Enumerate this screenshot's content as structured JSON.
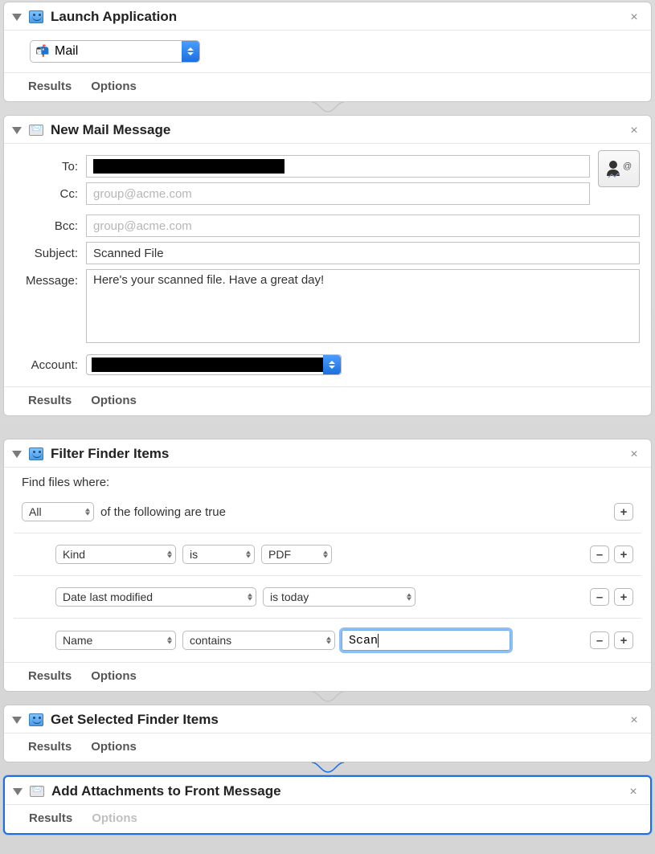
{
  "cards": {
    "launch": {
      "title": "Launch Application",
      "app_name": "Mail"
    },
    "newmail": {
      "title": "New Mail Message",
      "labels": {
        "to": "To:",
        "cc": "Cc:",
        "bcc": "Bcc:",
        "subject": "Subject:",
        "message": "Message:",
        "account": "Account:"
      },
      "to_value": "",
      "cc_placeholder": "group@acme.com",
      "bcc_placeholder": "group@acme.com",
      "subject_value": "Scanned File",
      "message_value": "Here's your scanned file. Have a great day!",
      "account_value": ""
    },
    "filter": {
      "title": "Filter Finder Items",
      "prompt": "Find files where:",
      "all_label": "All",
      "of_true": "of the following are true",
      "rows": [
        {
          "attr": "Kind",
          "op": "is",
          "val": "PDF"
        },
        {
          "attr": "Date last modified",
          "op": "is today"
        },
        {
          "attr": "Name",
          "op": "contains",
          "text": "Scan"
        }
      ]
    },
    "getsel": {
      "title": "Get Selected Finder Items"
    },
    "addatt": {
      "title": "Add Attachments to Front Message"
    }
  },
  "footer": {
    "results": "Results",
    "options": "Options"
  },
  "buttons": {
    "plus": "+",
    "minus": "–"
  }
}
